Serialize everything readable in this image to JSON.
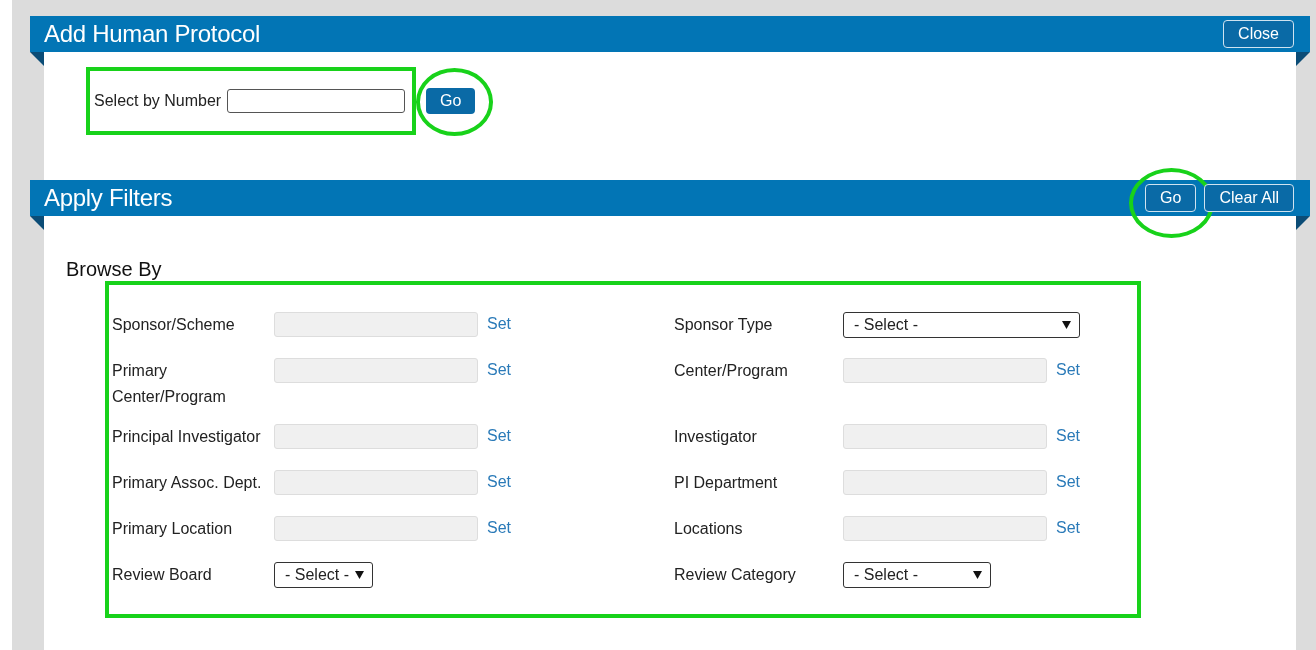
{
  "dialog": {
    "title": "Add Human Protocol",
    "close_button": "Close"
  },
  "number_section": {
    "label": "Select by Number",
    "go_button": "Go",
    "highlighted": true,
    "go_circled": true
  },
  "filters": {
    "title": "Apply Filters",
    "go_button": "Go",
    "go_circled": true,
    "clear_button": "Clear All",
    "browse_heading": "Browse By",
    "highlighted": true,
    "rows": [
      {
        "left": {
          "kind": "lookup",
          "label": "Sponsor/Scheme",
          "action": "Set"
        },
        "right": {
          "kind": "select",
          "label": "Sponsor Type",
          "value": "- Select -"
        }
      },
      {
        "left": {
          "kind": "lookup",
          "label": "Primary Center/Program",
          "action": "Set"
        },
        "right": {
          "kind": "lookup",
          "label": "Center/Program",
          "action": "Set"
        }
      },
      {
        "left": {
          "kind": "lookup",
          "label": "Principal Investigator",
          "action": "Set"
        },
        "right": {
          "kind": "lookup",
          "label": "Investigator",
          "action": "Set"
        }
      },
      {
        "left": {
          "kind": "lookup",
          "label": "Primary Assoc. Dept.",
          "action": "Set"
        },
        "right": {
          "kind": "lookup",
          "label": "PI Department",
          "action": "Set"
        }
      },
      {
        "left": {
          "kind": "lookup",
          "label": "Primary Location",
          "action": "Set"
        },
        "right": {
          "kind": "lookup",
          "label": "Locations",
          "action": "Set"
        }
      },
      {
        "left": {
          "kind": "select",
          "label": "Review Board",
          "value": "- Select -"
        },
        "right": {
          "kind": "select",
          "label": "Review Category",
          "value": "- Select -"
        }
      }
    ]
  }
}
